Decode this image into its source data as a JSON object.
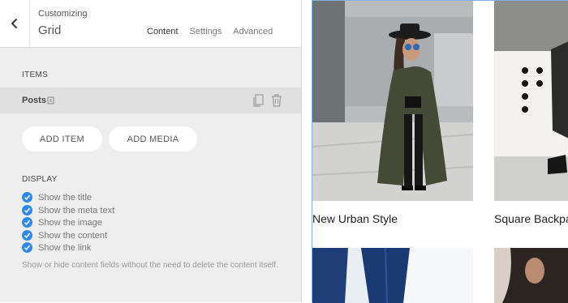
{
  "header": {
    "breadcrumb": "Customizing",
    "title": "Grid",
    "tabs": [
      {
        "label": "Content",
        "active": true
      },
      {
        "label": "Settings",
        "active": false
      },
      {
        "label": "Advanced",
        "active": false
      }
    ]
  },
  "items": {
    "heading": "ITEMS",
    "rows": [
      {
        "label": "Posts"
      }
    ],
    "add_item_label": "ADD ITEM",
    "add_media_label": "ADD MEDIA"
  },
  "display": {
    "heading": "DISPLAY",
    "options": [
      {
        "label": "Show the title",
        "checked": true
      },
      {
        "label": "Show the meta text",
        "checked": true
      },
      {
        "label": "Show the image",
        "checked": true
      },
      {
        "label": "Show the content",
        "checked": true
      },
      {
        "label": "Show the link",
        "checked": true
      }
    ],
    "help": "Show or hide content fields without the need to delete the content itself."
  },
  "preview": {
    "cards": [
      {
        "title": "New Urban Style"
      },
      {
        "title": "Square Backpack"
      }
    ]
  },
  "colors": {
    "accent": "#2e8ae6",
    "panel_bg": "#eeeeee",
    "preview_border": "#7fb0e6"
  }
}
